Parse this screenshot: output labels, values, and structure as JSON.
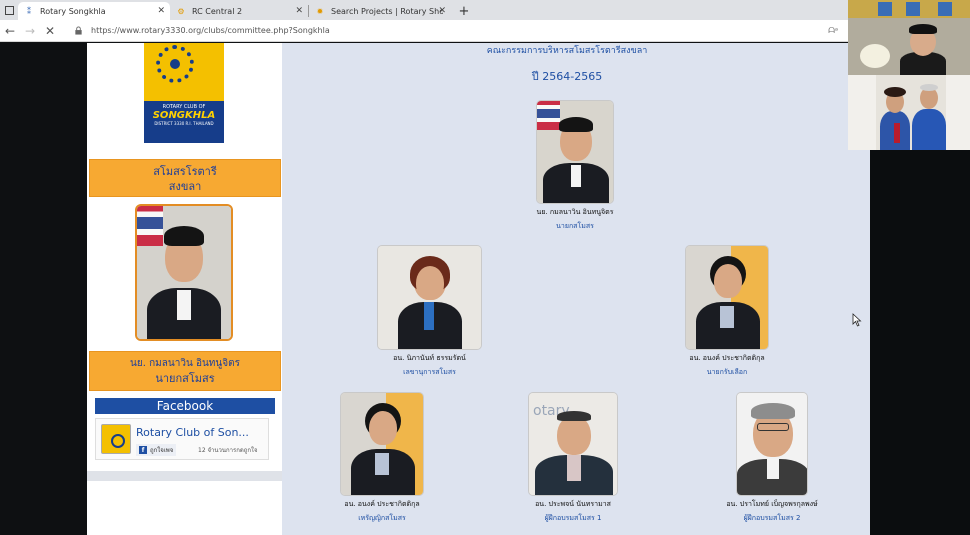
{
  "browser": {
    "tabs": [
      {
        "title": "Rotary Songkhla",
        "active": true,
        "favicon": "rotary-icon"
      },
      {
        "title": "RC Central 2",
        "active": false,
        "favicon": "rotary-gear-icon"
      },
      {
        "title": "Search Projects | Rotary Showca",
        "active": false,
        "favicon": "rotary-icon"
      }
    ],
    "new_tab_label": "+",
    "url": "https://www.rotary3330.org/clubs/committee.php?Songkhla"
  },
  "sidebar": {
    "logo": {
      "line1": "ROTARY CLUB OF",
      "line2": "SONGKHLA",
      "line3": "DISTRICT 3330 R.I. THAILAND"
    },
    "club_name_line1": "สโมสรโรตารี",
    "club_name_line2": "สงขลา",
    "president_name": "นย. กมลนาวิน อินทนูจิตร",
    "president_title": "นายกสโมสร",
    "facebook_label": "Facebook",
    "fb_page_name": "Rotary Club of Son...",
    "fb_like_label": "ถูกใจเพจ",
    "fb_like_count": "12 จำนวนการกดถูกใจ"
  },
  "content": {
    "heading": "คณะกรรมการบริหารสโมสรโรตารีสงขลา",
    "year": "ปี 2564-2565",
    "members": [
      {
        "name": "นย. กมลนาวิน อินทนูจิตร",
        "role": "นายกสโมสร"
      },
      {
        "name": "อน. นิภานันท์ ธรรมรัตน์",
        "role": "เลขานุการสโมสร"
      },
      {
        "name": "อน. อนงค์ ประชากิตติกุล",
        "role": "นายกรับเลือก"
      },
      {
        "name": "อน. อนงค์ ประชากิตติกุล",
        "role": "เหรัญญิกสโมสร"
      },
      {
        "name": "อน. ประพจน์ นันทรามาส",
        "role": "ผู้ฝึกอบรมสโมสร 1"
      },
      {
        "name": "อน. ปราโมทย์ เบ็ญจพรกุลพงษ์",
        "role": "ผู้ฝึกอบรมสโมสร 2"
      }
    ]
  }
}
